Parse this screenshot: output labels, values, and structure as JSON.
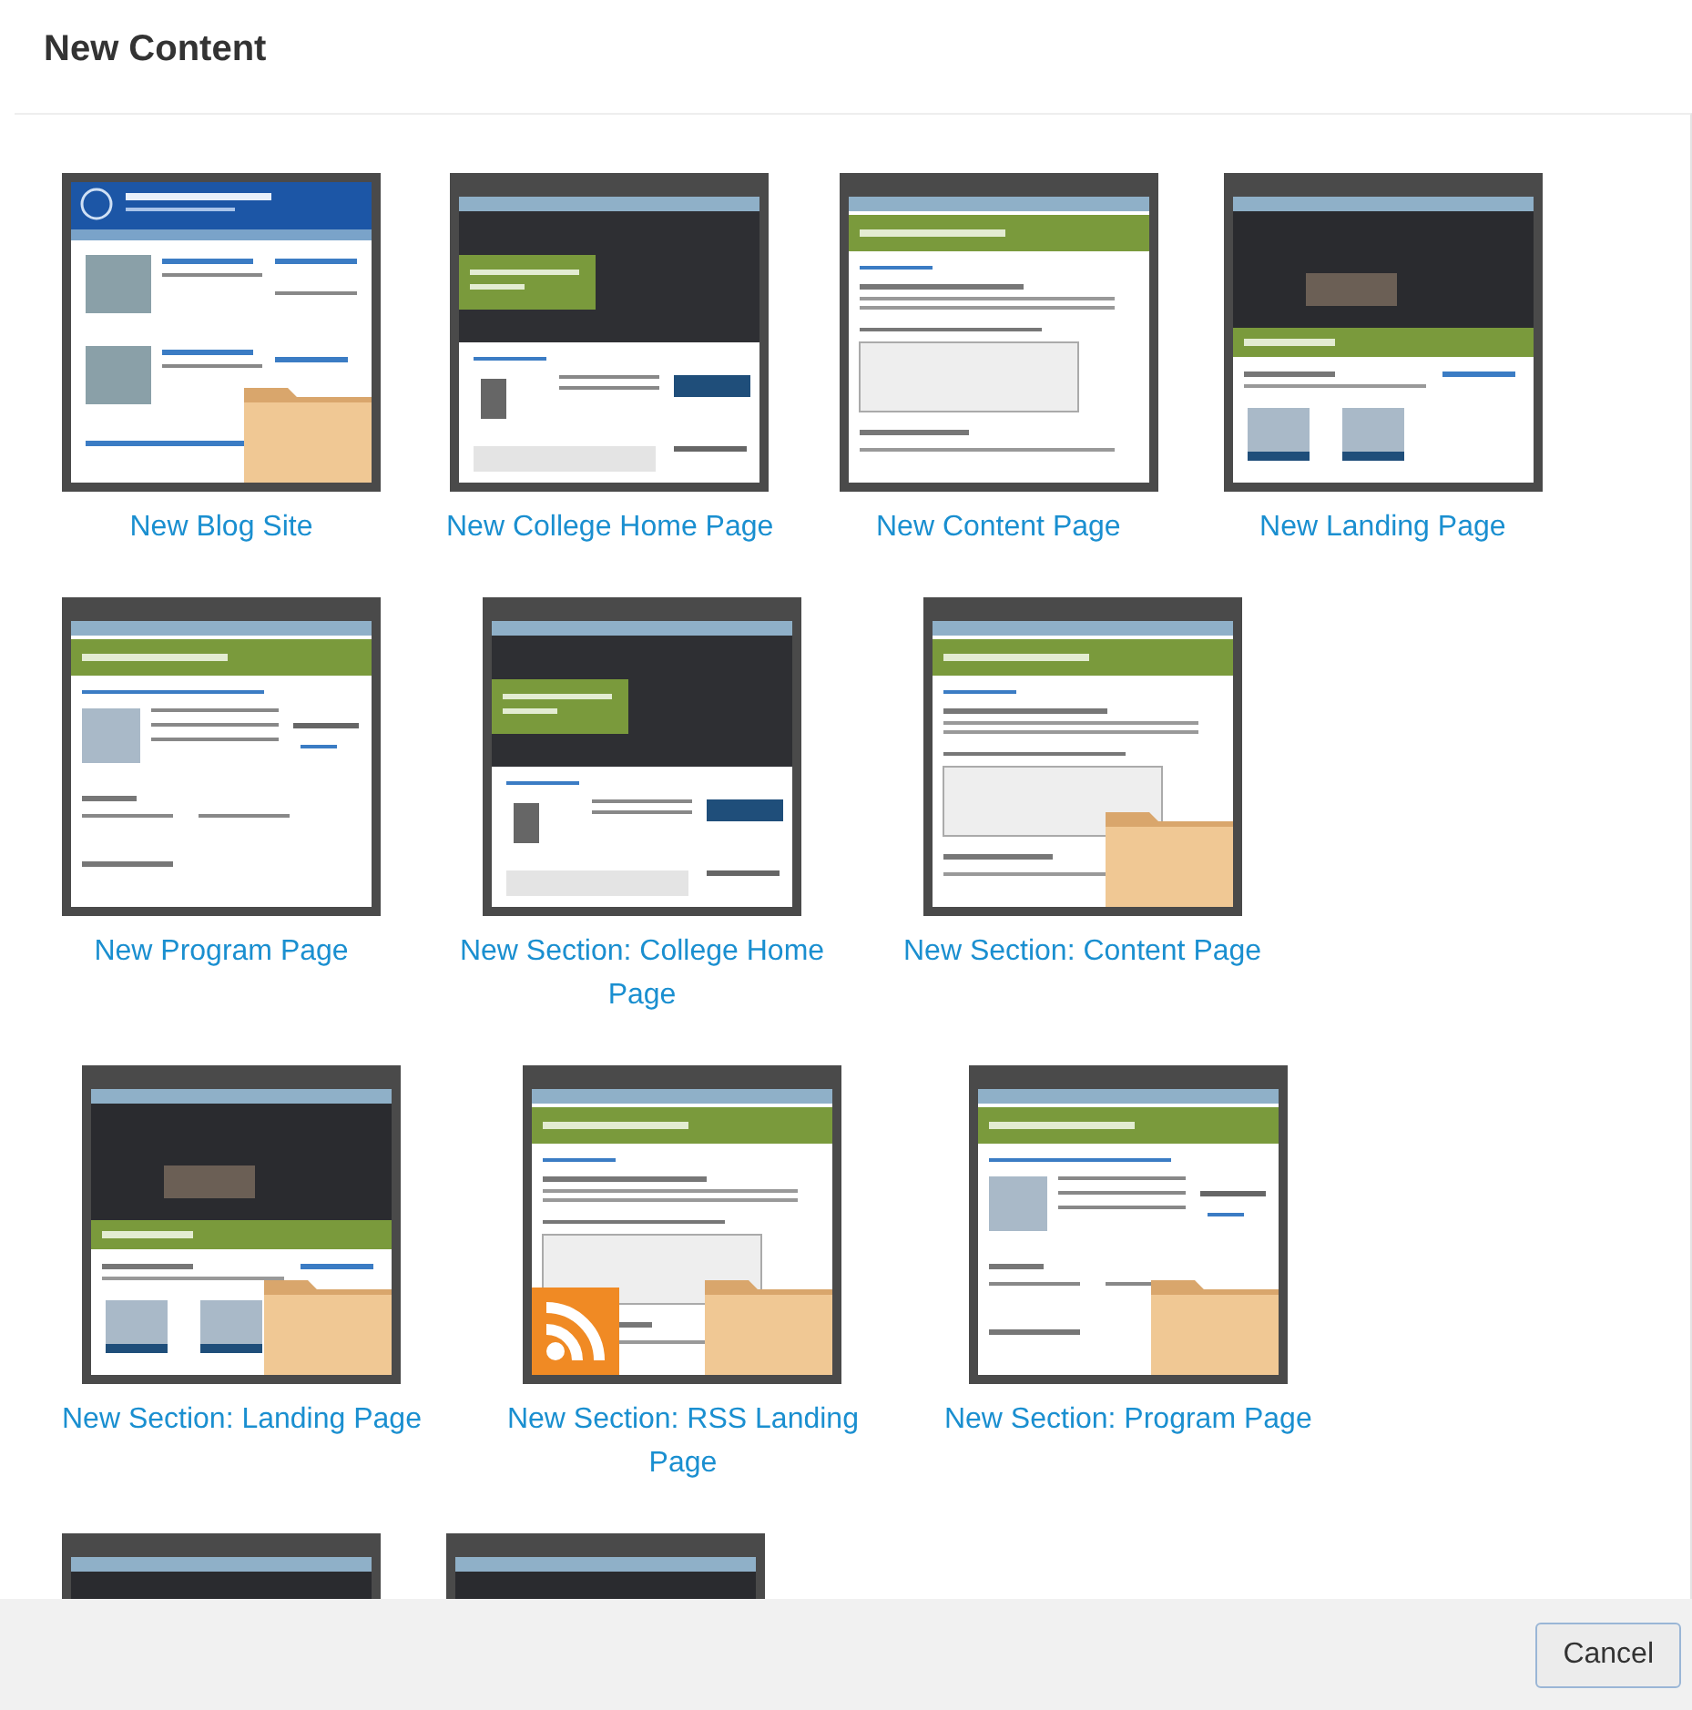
{
  "dialog": {
    "title": "New Content"
  },
  "templates": [
    {
      "kind": "blog",
      "label": "New Blog Site",
      "folder": true,
      "rss": false
    },
    {
      "kind": "college",
      "label": "New College Home Page",
      "folder": false,
      "rss": false
    },
    {
      "kind": "content",
      "label": "New Content Page",
      "folder": false,
      "rss": false
    },
    {
      "kind": "landing",
      "label": "New Landing Page",
      "folder": false,
      "rss": false
    },
    {
      "kind": "program",
      "label": "New Program Page",
      "folder": false,
      "rss": false
    },
    {
      "kind": "college",
      "label": "New Section: College Home Page",
      "folder": false,
      "rss": false
    },
    {
      "kind": "content",
      "label": "New Section: Content Page",
      "folder": true,
      "rss": false
    },
    {
      "kind": "landing",
      "label": "New Section: Landing Page",
      "folder": true,
      "rss": false
    },
    {
      "kind": "content",
      "label": "New Section: RSS Landing Page",
      "folder": true,
      "rss": true
    },
    {
      "kind": "program",
      "label": "New Section: Program Page",
      "folder": true,
      "rss": false
    },
    {
      "kind": "landing"
    },
    {
      "kind": "landing"
    }
  ],
  "buttons": [
    {
      "label": "Cancel"
    }
  ]
}
